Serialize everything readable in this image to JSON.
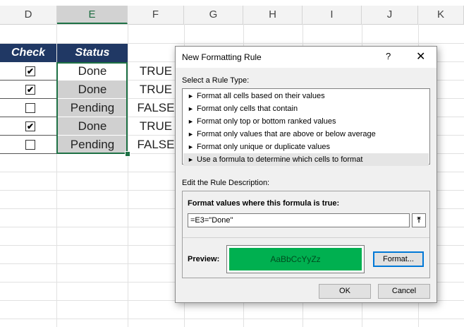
{
  "spreadsheet": {
    "columns": [
      "D",
      "E",
      "F",
      "G",
      "H",
      "I",
      "J",
      "K"
    ],
    "selected_column": "E",
    "headers": {
      "check": "Check",
      "status": "Status"
    },
    "rows": [
      {
        "checked": true,
        "status": "Done",
        "result": "TRUE"
      },
      {
        "checked": true,
        "status": "Done",
        "result": "TRUE"
      },
      {
        "checked": false,
        "status": "Pending",
        "result": "FALSE"
      },
      {
        "checked": true,
        "status": "Done",
        "result": "TRUE"
      },
      {
        "checked": false,
        "status": "Pending",
        "result": "FALSE"
      }
    ],
    "checkmark_glyph": "✔",
    "header_color": "#203864",
    "selection_color": "#1e7145"
  },
  "dialog": {
    "title": "New Formatting Rule",
    "help": "?",
    "close": "✕",
    "rule_type_label": "Select a Rule Type:",
    "rule_types": [
      "Format all cells based on their values",
      "Format only cells that contain",
      "Format only top or bottom ranked values",
      "Format only values that are above or below average",
      "Format only unique or duplicate values",
      "Use a formula to determine which cells to format"
    ],
    "selected_rule_index": 5,
    "rule_arrow": "►",
    "edit_label": "Edit the Rule Description:",
    "formula_label": "Format values where this formula is true:",
    "formula_value": "=E3=\"Done\"",
    "collapse_icon": "collapse-dialog-icon",
    "preview_label": "Preview:",
    "preview_text": "AaBbCcYyZz",
    "preview_fill": "#00b050",
    "format_button": "Format...",
    "ok_button": "OK",
    "cancel_button": "Cancel"
  }
}
